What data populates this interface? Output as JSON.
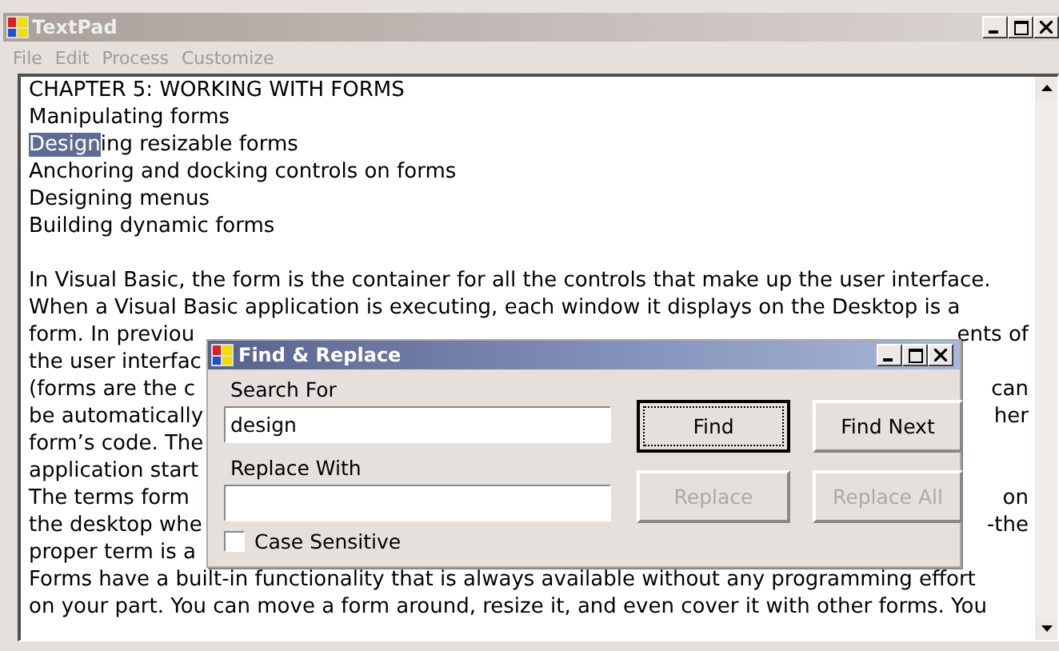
{
  "window": {
    "title": "TextPad"
  },
  "menu": [
    "File",
    "Edit",
    "Process",
    "Customize"
  ],
  "editor": {
    "lines": [
      {
        "kind": "text",
        "segments": [
          {
            "text": "CHAPTER 5: WORKING WITH FORMS",
            "selected": false
          }
        ]
      },
      {
        "kind": "text",
        "segments": [
          {
            "text": "Manipulating forms",
            "selected": false
          }
        ]
      },
      {
        "kind": "text",
        "segments": [
          {
            "text": "Design",
            "selected": true
          },
          {
            "text": "ing resizable forms",
            "selected": false
          }
        ]
      },
      {
        "kind": "text",
        "segments": [
          {
            "text": "Anchoring and docking controls on forms",
            "selected": false
          }
        ]
      },
      {
        "kind": "text",
        "segments": [
          {
            "text": "Designing menus",
            "selected": false
          }
        ]
      },
      {
        "kind": "text",
        "segments": [
          {
            "text": "Building dynamic forms",
            "selected": false
          }
        ]
      },
      {
        "kind": "blank"
      },
      {
        "kind": "text",
        "segments": [
          {
            "text": "In Visual Basic, the form is the container for all the controls that make up the user interface.",
            "selected": false
          }
        ]
      },
      {
        "kind": "text",
        "segments": [
          {
            "text": "When a Visual Basic application is executing, each window it displays on the Desktop is a",
            "selected": false
          }
        ]
      },
      {
        "kind": "text",
        "segments": [
          {
            "text": "form. In previou",
            "selected": false
          }
        ],
        "right": "ents of"
      },
      {
        "kind": "text",
        "segments": [
          {
            "text": "the user interfac",
            "selected": false
          }
        ]
      },
      {
        "kind": "text",
        "segments": [
          {
            "text": "(forms are the c",
            "selected": false
          }
        ],
        "right": "can"
      },
      {
        "kind": "text",
        "segments": [
          {
            "text": "be automatically",
            "selected": false
          }
        ],
        "right": "her"
      },
      {
        "kind": "text",
        "segments": [
          {
            "text": "form’s code. The",
            "selected": false
          }
        ]
      },
      {
        "kind": "text",
        "segments": [
          {
            "text": "application start",
            "selected": false
          }
        ]
      },
      {
        "kind": "text",
        "segments": [
          {
            "text": "The terms form",
            "selected": false
          }
        ],
        "right": "on"
      },
      {
        "kind": "text",
        "segments": [
          {
            "text": "the desktop whe",
            "selected": false
          }
        ],
        "right": "-the"
      },
      {
        "kind": "text",
        "segments": [
          {
            "text": "proper term is a",
            "selected": false
          }
        ]
      },
      {
        "kind": "text",
        "segments": [
          {
            "text": "Forms have a built-in functionality that is always available without any programming effort",
            "selected": false
          }
        ]
      },
      {
        "kind": "text",
        "segments": [
          {
            "text": "on your part. You can move a form around, resize it, and even cover it with other forms. You",
            "selected": false
          }
        ]
      }
    ]
  },
  "dialog": {
    "title": "Find & Replace",
    "search_label": "Search For",
    "search_value": "design",
    "replace_label": "Replace With",
    "buttons": [
      {
        "label": "Find",
        "disabled": false,
        "default": true
      },
      {
        "label": "Find Next",
        "disabled": false,
        "default": false
      },
      {
        "label": "Replace",
        "disabled": true,
        "default": false
      },
      {
        "label": "Replace All",
        "disabled": true,
        "default": false
      }
    ],
    "case_sensitive": {
      "label": "Case Sensitive",
      "checked": false
    }
  }
}
